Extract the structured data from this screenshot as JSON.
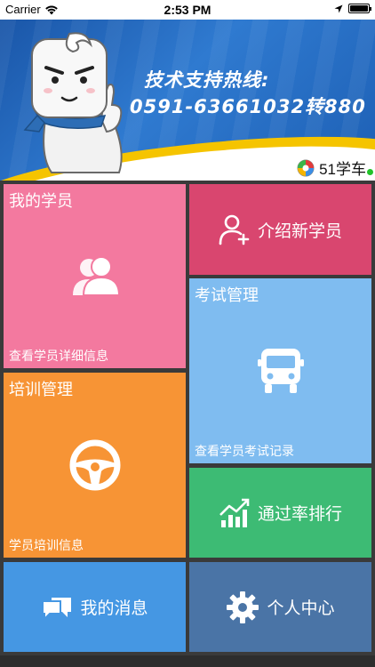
{
  "status_bar": {
    "carrier": "Carrier",
    "time": "2:53 PM"
  },
  "banner": {
    "hotline_title": "技术支持热线:",
    "hotline_number": "0591-63661032转880",
    "brand_name": "51学车"
  },
  "tiles": {
    "my_students": {
      "title": "我的学员",
      "subtitle": "查看学员详细信息",
      "icon": "users-icon"
    },
    "introduce_new": {
      "label": "介绍新学员",
      "icon": "add-user-icon"
    },
    "exam_management": {
      "title": "考试管理",
      "subtitle": "查看学员考试记录",
      "icon": "bus-icon"
    },
    "training_management": {
      "title": "培训管理",
      "subtitle": "学员培训信息",
      "icon": "steering-wheel-icon"
    },
    "pass_rate": {
      "label": "通过率排行",
      "icon": "growth-chart-icon"
    },
    "my_messages": {
      "label": "我的消息",
      "icon": "chat-bubbles-icon"
    },
    "personal_center": {
      "label": "个人中心",
      "icon": "gear-icon"
    }
  },
  "colors": {
    "my_students": "#f3799f",
    "introduce_new": "#d9466f",
    "exam_management": "#7fbcf0",
    "training_management": "#f79435",
    "pass_rate": "#3dbb74",
    "my_messages": "#4597e3",
    "personal_center": "#4a74a6"
  }
}
